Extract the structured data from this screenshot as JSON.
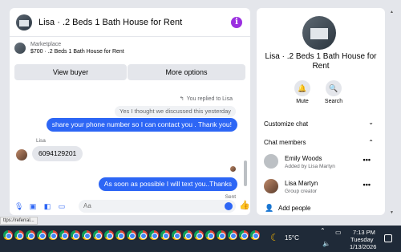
{
  "chat": {
    "title": "Lisa · .2 Beds 1 Bath House for Rent",
    "info_icon": "info-icon",
    "marketplace_label": "Marketplace",
    "marketplace_item": "$700 · .2 Beds 1 Bath House for Rent",
    "view_buyer_label": "View buyer",
    "more_options_label": "More options",
    "replied_note": "You replied to Lisa",
    "quoted_message": "Yes I thought we discussed this yesterday",
    "outgoing_1": "share your phone number so I can contact you . Thank you!",
    "sender_name": "Lisa",
    "incoming_1": "6094129201",
    "outgoing_2": "As soon as possible I will text you..Thanks",
    "sent_status": "Sent",
    "composer_placeholder": "Aa"
  },
  "side": {
    "title": "Lisa · .2 Beds 1 Bath House for Rent",
    "mute_label": "Mute",
    "search_label": "Search",
    "customize_label": "Customize chat",
    "members_label": "Chat members",
    "members": [
      {
        "name": "Emily Woods",
        "sub": "Added by Lisa Martyn"
      },
      {
        "name": "Lisa Martyn",
        "sub": "Group creator"
      }
    ],
    "add_people_label": "Add people"
  },
  "status_link": "ttps://referral...",
  "taskbar": {
    "weather_temp": "15°C",
    "time": "7:13 PM",
    "day": "Tuesday",
    "date": "1/13/2026",
    "app_icon": "chrome-icon",
    "app_count": 23
  },
  "colors": {
    "accent": "#2d66f5",
    "info": "#9b2fe0",
    "taskbar": "#1f2a38"
  }
}
